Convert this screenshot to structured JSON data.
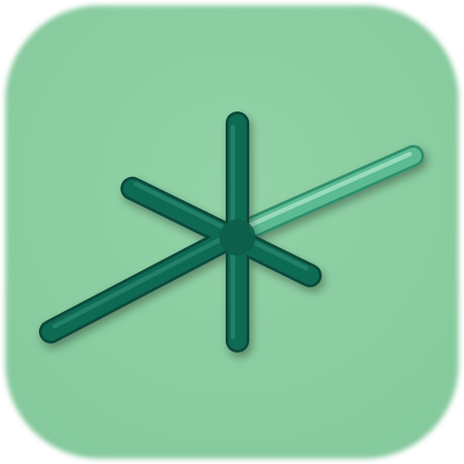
{
  "icon": {
    "name": "asterisk-slash-app-icon",
    "colors": {
      "tile": "#8ccfa2",
      "tile_edge": "#74c28e",
      "stroke_dark": "#0b6650",
      "stroke_dark_edge": "#074a3a",
      "stroke_light": "#52b48a",
      "highlight": "#a8e3c6"
    }
  }
}
